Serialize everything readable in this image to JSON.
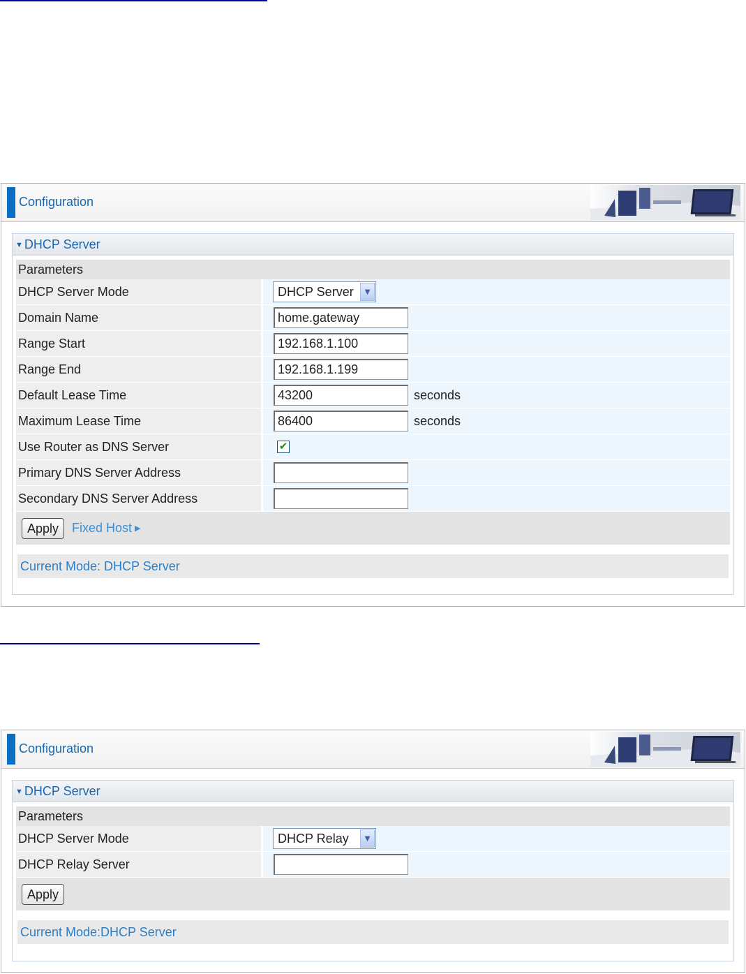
{
  "panels": [
    {
      "title": "Configuration",
      "section_title": "DHCP Server",
      "params_label": "Parameters",
      "rows": {
        "mode_label": "DHCP Server Mode",
        "mode_value": "DHCP Server",
        "domain_label": "Domain Name",
        "domain_value": "home.gateway",
        "range_start_label": "Range Start",
        "range_start_value": "192.168.1.100",
        "range_end_label": "Range End",
        "range_end_value": "192.168.1.199",
        "default_lease_label": "Default Lease Time",
        "default_lease_value": "43200",
        "default_lease_unit": "seconds",
        "max_lease_label": "Maximum Lease Time",
        "max_lease_value": "86400",
        "max_lease_unit": "seconds",
        "use_router_dns_label": "Use Router as DNS Server",
        "use_router_dns_checked": true,
        "primary_dns_label": "Primary DNS Server Address",
        "primary_dns_value": "",
        "secondary_dns_label": "Secondary DNS Server Address",
        "secondary_dns_value": ""
      },
      "apply_label": "Apply",
      "fixed_host_label": "Fixed Host",
      "current_mode": "Current Mode: DHCP Server"
    },
    {
      "title": "Configuration",
      "section_title": "DHCP Server",
      "params_label": "Parameters",
      "rows": {
        "mode_label": "DHCP Server Mode",
        "mode_value": "DHCP Relay",
        "relay_label": "DHCP Relay Server",
        "relay_value": ""
      },
      "apply_label": "Apply",
      "current_mode": "Current Mode:DHCP Server"
    }
  ],
  "colors": {
    "accent": "#0a6fc4",
    "link": "#3b8fd6",
    "rule": "#000099"
  },
  "icons": {
    "header_art": "office-chairs-monitor-graphic",
    "section_toggle": "triangle-down-icon",
    "link_caret": "triangle-right-icon",
    "check": "checkmark-icon",
    "dropdown": "chevron-down-icon"
  }
}
